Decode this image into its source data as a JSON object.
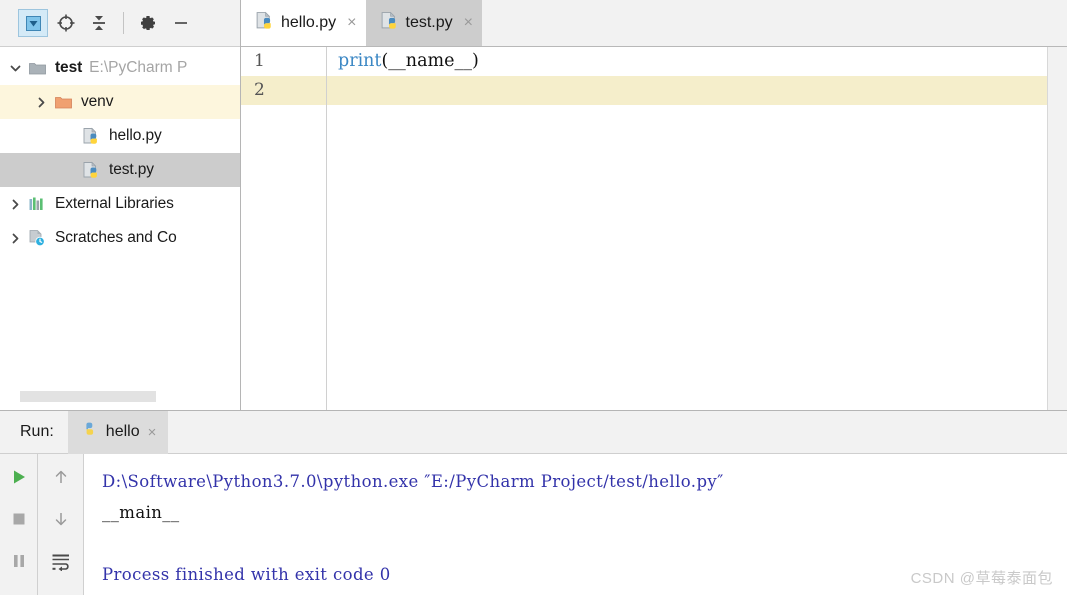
{
  "project_panel": {
    "toolbar": [
      {
        "name": "select-opened-file-icon",
        "glyph": "select",
        "selected": true
      },
      {
        "name": "locate-target-icon",
        "glyph": "target",
        "selected": false
      },
      {
        "name": "collapse-all-icon",
        "glyph": "collapse",
        "selected": false
      },
      {
        "name": "settings-gear-icon",
        "glyph": "gear",
        "selected": false
      },
      {
        "name": "hide-panel-icon",
        "glyph": "minus",
        "selected": false
      }
    ],
    "tree": [
      {
        "label": "test",
        "path": "E:\\PyCharm P",
        "icon": "folder-grey-icon",
        "twisty": "expanded",
        "bold": true,
        "indent": 1,
        "highlight": "none"
      },
      {
        "label": "venv",
        "path": "",
        "icon": "folder-orange-icon",
        "twisty": "collapsed",
        "bold": false,
        "indent": 2,
        "highlight": "yellow"
      },
      {
        "label": "hello.py",
        "path": "",
        "icon": "python-file-icon",
        "twisty": "none",
        "bold": false,
        "indent": 3,
        "highlight": "none"
      },
      {
        "label": "test.py",
        "path": "",
        "icon": "python-file-icon",
        "twisty": "none",
        "bold": false,
        "indent": 3,
        "highlight": "grey"
      },
      {
        "label": "External Libraries",
        "path": "",
        "icon": "libraries-bars-icon",
        "twisty": "collapsed",
        "bold": false,
        "indent": 1,
        "highlight": "none"
      },
      {
        "label": "Scratches and Co",
        "path": "",
        "icon": "scratches-clock-icon",
        "twisty": "collapsed",
        "bold": false,
        "indent": 1,
        "highlight": "none"
      }
    ]
  },
  "editor": {
    "tabs": [
      {
        "label": "hello.py",
        "icon": "python-file-icon",
        "active": true,
        "close": "×"
      },
      {
        "label": "test.py",
        "icon": "python-file-icon",
        "active": false,
        "close": "×"
      }
    ],
    "lines": [
      {
        "number": "1",
        "current": false,
        "tokens": [
          {
            "text": "print",
            "type": "fn"
          },
          {
            "text": "(__name__)",
            "type": "plain"
          }
        ]
      },
      {
        "number": "2",
        "current": true,
        "tokens": []
      }
    ]
  },
  "run_panel": {
    "label": "Run:",
    "tab": {
      "label": "hello",
      "icon": "python-run-icon",
      "close": "×"
    },
    "toolbar_left": [
      {
        "name": "rerun-button",
        "glyph": "play"
      },
      {
        "name": "stop-button",
        "glyph": "stop"
      },
      {
        "name": "pause-button",
        "glyph": "pause"
      }
    ],
    "toolbar_right": [
      {
        "name": "up-the-stack-trace-button",
        "glyph": "arrow-up"
      },
      {
        "name": "down-the-stack-trace-button",
        "glyph": "arrow-down"
      },
      {
        "name": "soft-wrap-button",
        "glyph": "wrap"
      }
    ],
    "console": [
      {
        "text": "D:\\Software\\Python3.7.0\\python.exe ″E:/PyCharm Project/test/hello.py″",
        "type": "cmd"
      },
      {
        "text": "__main__",
        "type": "out"
      },
      {
        "text": "",
        "type": "out"
      },
      {
        "text": "Process finished with exit code 0",
        "type": "status"
      }
    ]
  },
  "watermark": "CSDN @草莓泰面包",
  "colors": {
    "accent_selected": "#d4eaf7",
    "current_line": "#f5eecb",
    "tree_selection": "#cccccc",
    "keyword_blue": "#3b87c4",
    "console_blue": "#3333aa",
    "run_green": "#4caf50",
    "folder_orange": "#f0a070"
  }
}
